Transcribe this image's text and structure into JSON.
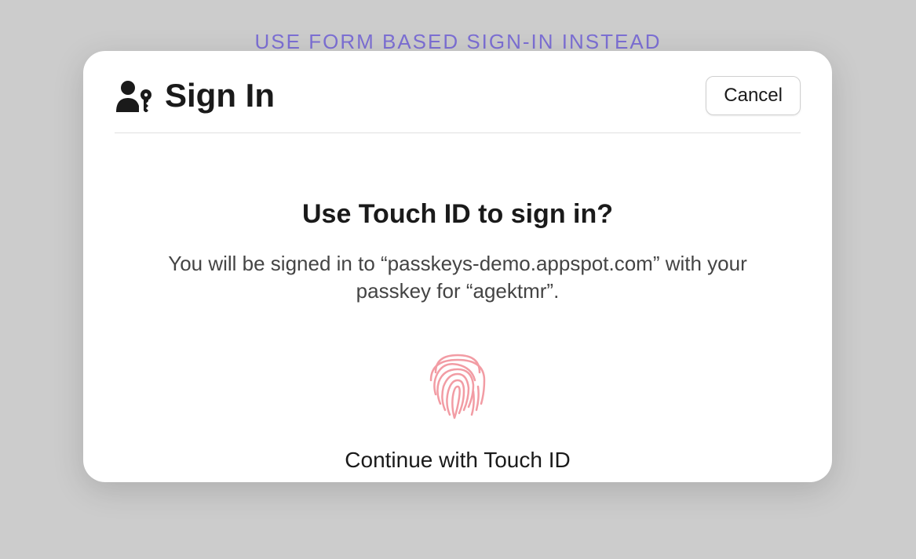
{
  "background": {
    "link_text": "USE FORM BASED SIGN-IN INSTEAD"
  },
  "dialog": {
    "title": "Sign In",
    "cancel_label": "Cancel",
    "prompt_heading": "Use Touch ID to sign in?",
    "prompt_description": "You will be signed in to “passkeys-demo.appspot.com” with your passkey for “agektmr”.",
    "continue_label": "Continue with Touch ID"
  },
  "colors": {
    "link": "#7c6fd4",
    "fingerprint": "#f29ca4"
  }
}
